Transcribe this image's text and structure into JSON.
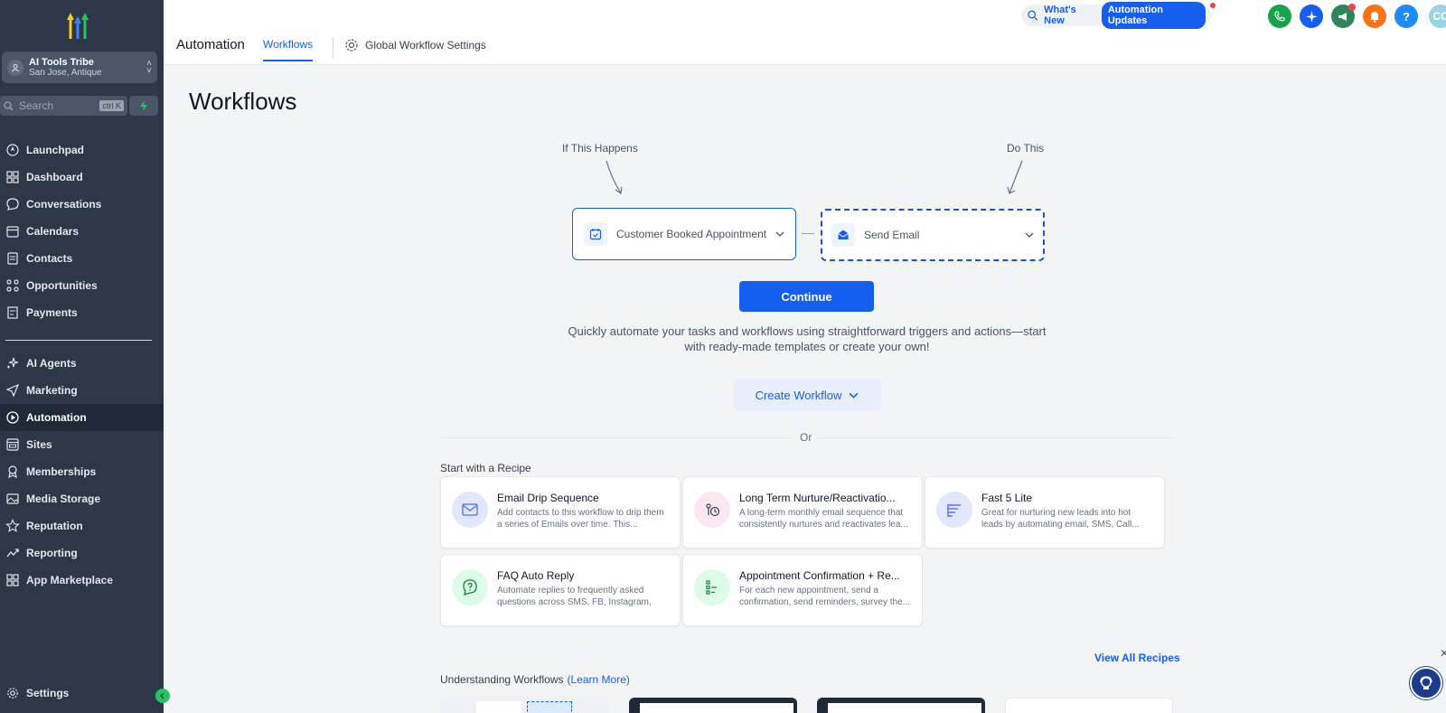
{
  "account": {
    "name": "AI Tools Tribe",
    "location": "San Jose, Antique"
  },
  "search": {
    "placeholder": "Search",
    "shortcut": "ctrl K"
  },
  "nav": {
    "top": [
      {
        "label": "Launchpad",
        "icon": "launchpad-icon"
      },
      {
        "label": "Dashboard",
        "icon": "dashboard-icon"
      },
      {
        "label": "Conversations",
        "icon": "chat-icon"
      },
      {
        "label": "Calendars",
        "icon": "calendar-icon"
      },
      {
        "label": "Contacts",
        "icon": "contacts-icon"
      },
      {
        "label": "Opportunities",
        "icon": "opportunities-icon"
      },
      {
        "label": "Payments",
        "icon": "payments-icon"
      }
    ],
    "bottom": [
      {
        "label": "AI Agents",
        "icon": "sparkle-icon"
      },
      {
        "label": "Marketing",
        "icon": "send-icon"
      },
      {
        "label": "Automation",
        "icon": "automation-icon",
        "active": true
      },
      {
        "label": "Sites",
        "icon": "sites-icon"
      },
      {
        "label": "Memberships",
        "icon": "memberships-icon"
      },
      {
        "label": "Media Storage",
        "icon": "image-icon"
      },
      {
        "label": "Reputation",
        "icon": "star-icon"
      },
      {
        "label": "Reporting",
        "icon": "chart-icon"
      },
      {
        "label": "App Marketplace",
        "icon": "grid-icon"
      }
    ],
    "settings": "Settings"
  },
  "header": {
    "title": "Automation",
    "tab_workflows": "Workflows",
    "tab_global_settings": "Global Workflow Settings",
    "whats_new": "What's New",
    "automation_updates": "Automation Updates",
    "avatar_initials": "CC",
    "help_glyph": "?"
  },
  "main": {
    "title": "Workflows",
    "if_label": "If This Happens",
    "do_label": "Do This",
    "trigger": "Customer Booked Appointment",
    "action": "Send Email",
    "continue_label": "Continue",
    "description": "Quickly automate your tasks and workflows using straightforward triggers and actions—start with ready-made templates or create your own!",
    "create_workflow": "Create Workflow",
    "or": "Or",
    "recipe_heading": "Start with a Recipe",
    "recipes": [
      {
        "title": "Email Drip Sequence",
        "desc": "Add contacts to this workflow to drip them a series of Emails over time. This...",
        "icon": "mail-icon",
        "color": "#e0e7ff"
      },
      {
        "title": "Long Term Nurture/Reactivatio...",
        "desc": "A long-term monthly email sequence that consistently nurtures and reactivates lea...",
        "icon": "nurture-icon",
        "color": "#fce7f3"
      },
      {
        "title": "Fast 5 Lite",
        "desc": "Great for nurturing new leads into hot leads by automating email, SMS, Call...",
        "icon": "funnel-icon",
        "color": "#e0e7ff"
      },
      {
        "title": "FAQ Auto Reply",
        "desc": "Automate replies to frequently asked questions across SMS, FB, Instagram, an...",
        "icon": "faq-icon",
        "color": "#dcfce7"
      },
      {
        "title": "Appointment Confirmation + Re...",
        "desc": "For each new appointment, send a confirmation, send reminders, survey the...",
        "icon": "checklist-icon",
        "color": "#dcfce7"
      }
    ],
    "view_all": "View All Recipes",
    "understanding": "Understanding Workflows",
    "learn_more": "(Learn More)"
  },
  "colors": {
    "accent": "#155eef",
    "sidebar": "#2d3748"
  }
}
